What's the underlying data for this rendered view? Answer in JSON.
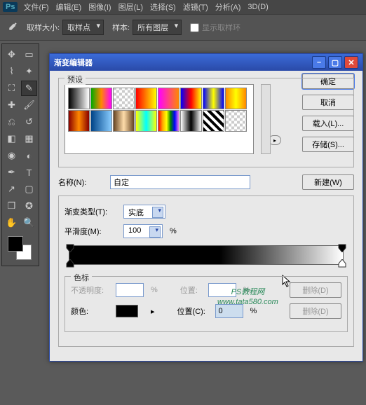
{
  "menu": {
    "items": [
      "文件(F)",
      "编辑(E)",
      "图像(I)",
      "图层(L)",
      "选择(S)",
      "滤镜(T)",
      "分析(A)",
      "3D(D)"
    ]
  },
  "optbar": {
    "size_label": "取样大小:",
    "size_value": "取样点",
    "sample_label": "样本:",
    "sample_value": "所有图层",
    "ring_label": "显示取样环"
  },
  "dialog": {
    "title": "渐变编辑器",
    "preset_label": "预设",
    "buttons": {
      "ok": "确定",
      "cancel": "取消",
      "load": "载入(L)...",
      "save": "存储(S)...",
      "new": "新建(W)",
      "delete": "删除(D)"
    },
    "name_label": "名称(N):",
    "name_value": "自定",
    "type_label": "渐变类型(T):",
    "type_value": "实底",
    "smooth_label": "平滑度(M):",
    "smooth_value": "100",
    "pct": "%",
    "stops_label": "色标",
    "opacity_label": "不透明度:",
    "opacity_value": "",
    "pos_label": "位置:",
    "pos_value": "",
    "color_label": "颜色:",
    "color_pos_label": "位置(C):",
    "color_pos_value": "0",
    "presets": [
      [
        "linear-gradient(to right,#000,#fff)",
        "linear-gradient(to right,#0a0,#f80,#f0f)",
        "repeating-conic-gradient(#ccc 0 25%,#fff 0 50%) 0/8px 8px",
        "linear-gradient(to right,#f00,#ff0)",
        "linear-gradient(to right,#f0f,#f80)",
        "linear-gradient(to right,#00f,#f00,#ff0)",
        "linear-gradient(to right,#00f,#ff0,#00f)",
        "linear-gradient(to right,#f80,#ff0,#f80)"
      ],
      [
        "linear-gradient(to right,#800,#f80,#800)",
        "linear-gradient(to right,#048,#8cf)",
        "linear-gradient(to right,#642,#fda,#642)",
        "linear-gradient(to right,#ff0,#0ff,#ff0)",
        "linear-gradient(to right,red,orange,yellow,green,blue,violet)",
        "linear-gradient(to right,#fff,#000,#fff)",
        "repeating-linear-gradient(45deg,#000 0 4px,#fff 4px 8px)",
        "repeating-conic-gradient(#ccc 0 25%,#fff 0 50%) 0/8px 8px"
      ]
    ]
  },
  "watermark": {
    "l1": "PS教程网",
    "l2": "www.tata580.com"
  }
}
